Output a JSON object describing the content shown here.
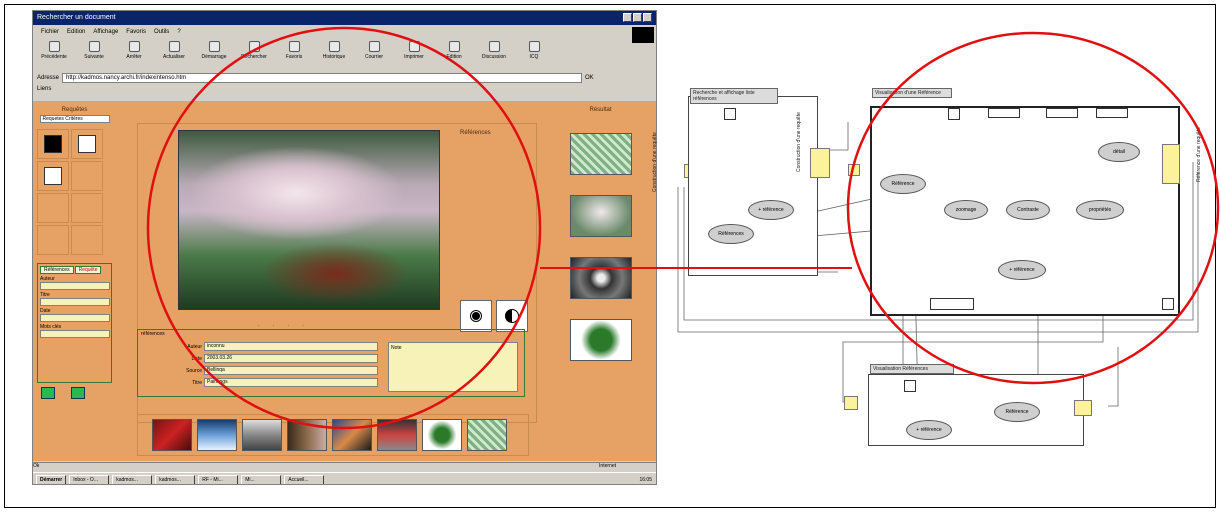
{
  "window": {
    "title": "Rechercher un document",
    "menu": [
      "Fichier",
      "Edition",
      "Affichage",
      "Favoris",
      "Outils",
      "?"
    ],
    "toolbar": [
      "Précédente",
      "Suivante",
      "Arrêter",
      "Actualiser",
      "Démarrage",
      "Rechercher",
      "Favoris",
      "Historique",
      "Courrier",
      "Imprimer",
      "Edition",
      "Discussion",
      "ICQ"
    ],
    "address_label": "Adresse",
    "address_value": "http://kadmos.nancy.archi.fr/indexintenso.htm",
    "go_label": "OK",
    "links_label": "Liens"
  },
  "left_panel": {
    "section_title": "Requêtes",
    "select_value": "Requetes Critères",
    "filter_tabs": [
      "Références",
      "Requête"
    ],
    "fields": [
      "Auteur",
      "Titre",
      "Date",
      "Mots clés"
    ]
  },
  "main": {
    "ref_label": "Références",
    "nav_dots": ". . . .",
    "info_title": "références",
    "info_rows": [
      {
        "k": "Auteur",
        "v": "inconnu"
      },
      {
        "k": "Date",
        "v": "2003.03.26"
      },
      {
        "k": "Source",
        "v": "Bellinqa"
      },
      {
        "k": "Titre",
        "v": "Paintings"
      }
    ],
    "note": "Note"
  },
  "right_panel": {
    "title": "Résultat"
  },
  "statusbar": {
    "left": "Ok",
    "zone": "Internet"
  },
  "taskbar": {
    "start": "Démarrer",
    "tasks": [
      "Inbox - O...",
      "kadmos...",
      "kadmos...",
      "RF - Mi...",
      "Mi...",
      "Accueil..."
    ],
    "clock": "16:05"
  },
  "diagram": {
    "box1_title": "Recherche et affichage\nliste références",
    "box2_title": "Visualisation d'une\nRéférence",
    "box3_title": "Visualisation Références",
    "label_left": "Construction d'une requête",
    "label_mid": "Construction d'une requête",
    "label_right": "Référence d'une requête",
    "box1_ellipses": [
      "+ référence",
      "Références"
    ],
    "box2_ellipses": [
      "Référence",
      "zoomage",
      "Contraste",
      "propriétés",
      "+ référence",
      "détail"
    ],
    "box3_ellipses": [
      "Référence",
      "+ référence"
    ]
  },
  "colors": {
    "annotation_red": "#e01010",
    "panel_orange": "#e6a265",
    "field_yellow": "#f6f2b8",
    "connector_yellow": "#fbf29b"
  }
}
